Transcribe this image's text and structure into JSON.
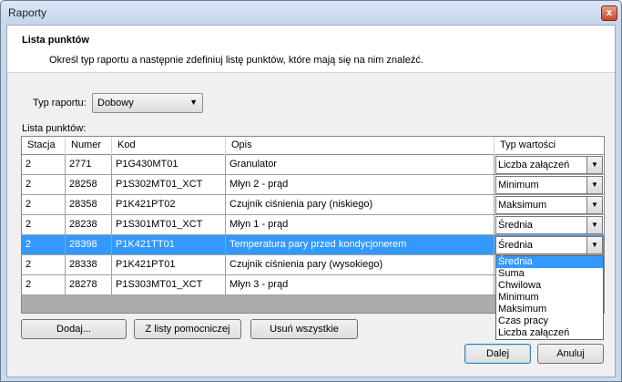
{
  "window": {
    "title": "Raporty",
    "close_glyph": "x"
  },
  "header": {
    "title": "Lista punktów",
    "description": "Określ typ raportu a następnie zdefiniuj listę punktów, które mają się na nim znaleźć."
  },
  "report_type": {
    "label": "Typ raportu:",
    "value": "Dobowy"
  },
  "points_list": {
    "label": "Lista punktów:",
    "columns": [
      "Stacja",
      "Numer",
      "Kod",
      "Opis",
      "Typ wartości"
    ],
    "rows": [
      {
        "station": "2",
        "number": "2771",
        "code": "P1G430MT01",
        "description": "Granulator",
        "value_type": "Liczba załączeń"
      },
      {
        "station": "2",
        "number": "28258",
        "code": "P1S302MT01_XCT",
        "description": "Młyn 2 - prąd",
        "value_type": "Minimum"
      },
      {
        "station": "2",
        "number": "28358",
        "code": "P1K421PT02",
        "description": "Czujnik ciśnienia pary (niskiego)",
        "value_type": "Maksimum"
      },
      {
        "station": "2",
        "number": "28238",
        "code": "P1S301MT01_XCT",
        "description": "Młyn 1 - prąd",
        "value_type": "Średnia"
      },
      {
        "station": "2",
        "number": "28398",
        "code": "P1K421TT01",
        "description": "Temperatura pary przed kondycjonerem",
        "value_type": "Średnia",
        "selected": true
      },
      {
        "station": "2",
        "number": "28338",
        "code": "P1K421PT01",
        "description": "Czujnik ciśnienia pary (wysokiego)",
        "value_type": ""
      },
      {
        "station": "2",
        "number": "28278",
        "code": "P1S303MT01_XCT",
        "description": "Młyn 3 - prąd",
        "value_type": ""
      }
    ]
  },
  "dropdown_options": [
    "Średnia",
    "Suma",
    "Chwilowa",
    "Minimum",
    "Maksimum",
    "Czas pracy",
    "Liczba załączeń"
  ],
  "dropdown_highlighted": "Średnia",
  "buttons": {
    "add": "Dodaj...",
    "from_aux_list": "Z listy pomocniczej",
    "remove_all": "Usuń wszystkie",
    "next": "Dalej",
    "cancel": "Anuluj"
  },
  "icons": {
    "dropdown_arrow": "▼"
  },
  "colors": {
    "selection": "#3399ff",
    "window_frame": "#c9d9ec"
  }
}
